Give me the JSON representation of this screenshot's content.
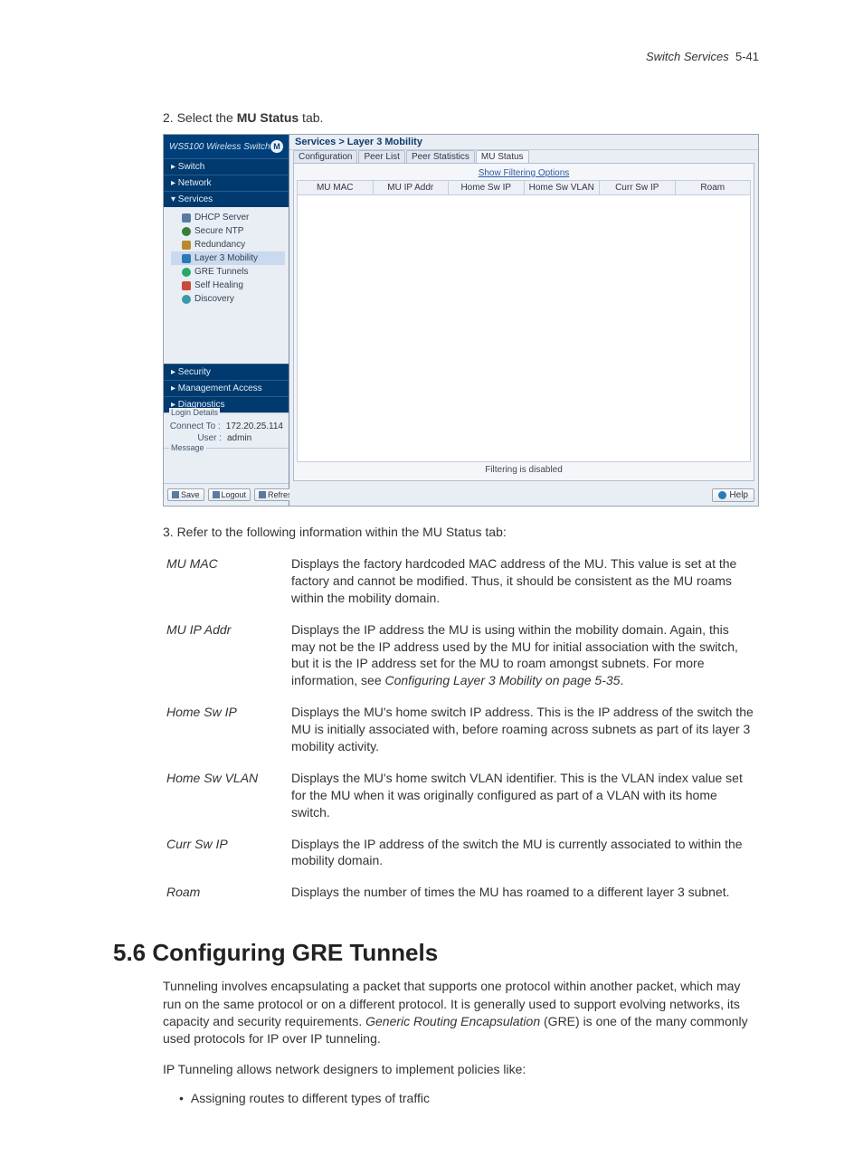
{
  "header": {
    "chapter": "Switch Services",
    "pagenum": "5-41"
  },
  "steps": {
    "s2_prefix": "2. Select the ",
    "s2_bold": "MU Status",
    "s2_suffix": " tab.",
    "s3": "3. Refer to the following information within the MU Status tab:"
  },
  "screenshot": {
    "title": "WS5100 Wireless Switch",
    "sidebar": {
      "items": [
        "▸ Switch",
        "▸ Network",
        "▾ Services"
      ],
      "services_children": [
        "DHCP Server",
        "Secure NTP",
        "Redundancy",
        "Layer 3 Mobility",
        "GRE Tunnels",
        "Self Healing",
        "Discovery"
      ],
      "items_tail": [
        "▸ Security",
        "▸ Management Access",
        "▸ Diagnostics"
      ],
      "login": {
        "legend": "Login Details",
        "connect_lab": "Connect To :",
        "connect_val": "172.20.25.114",
        "user_lab": "User :",
        "user_val": "admin"
      },
      "message_legend": "Message",
      "buttons": {
        "save": "Save",
        "logout": "Logout",
        "refresh": "Refresh"
      }
    },
    "main": {
      "crumb": "Services > Layer 3 Mobility",
      "tabs": [
        "Configuration",
        "Peer List",
        "Peer Statistics",
        "MU Status"
      ],
      "filter_link": "Show Filtering Options",
      "columns": [
        "MU MAC",
        "MU IP Addr",
        "Home Sw IP",
        "Home Sw VLAN",
        "Curr Sw IP",
        "Roam"
      ],
      "filter_status": "Filtering is disabled",
      "help_label": "Help"
    }
  },
  "defs": [
    {
      "term": "MU MAC",
      "desc": "Displays the factory hardcoded MAC address of the MU. This value is set at the factory and cannot be modified. Thus, it should be consistent as the MU roams within the mobility domain."
    },
    {
      "term": "MU IP Addr",
      "desc_pre": "Displays the IP address the MU is using within the mobility domain. Again, this may not be the IP address used by the MU for initial association with the switch, but it is the IP address set for the MU to roam amongst subnets. For more information, see ",
      "desc_ref": "Configuring Layer 3 Mobility on page 5-35",
      "desc_post": "."
    },
    {
      "term": "Home Sw IP",
      "desc": "Displays the MU's home switch IP address. This is the IP address of the switch the MU is initially associated with, before roaming across subnets as part of its layer 3 mobility activity."
    },
    {
      "term": "Home Sw VLAN",
      "desc": "Displays the MU's home switch VLAN identifier. This is the VLAN index value set for the MU when it was originally configured as part of a VLAN with its home switch."
    },
    {
      "term": "Curr Sw IP",
      "desc": "Displays the IP address of the switch the MU is currently associated to within the mobility domain."
    },
    {
      "term": "Roam",
      "desc": "Displays the number of times the MU has roamed to a different layer 3 subnet."
    }
  ],
  "section": {
    "h2": "5.6 Configuring GRE Tunnels",
    "p1_pre": "Tunneling involves encapsulating a packet that supports one protocol within another packet, which may run on the same protocol or on a different protocol. It is generally used to support evolving networks, its capacity and security requirements. ",
    "p1_em": "Generic Routing Encapsulation",
    "p1_post": " (GRE) is one of the many commonly used protocols for IP over IP tunneling.",
    "p2": "IP Tunneling allows network designers to implement policies like:",
    "bullet1": "Assigning routes to different types of traffic"
  }
}
